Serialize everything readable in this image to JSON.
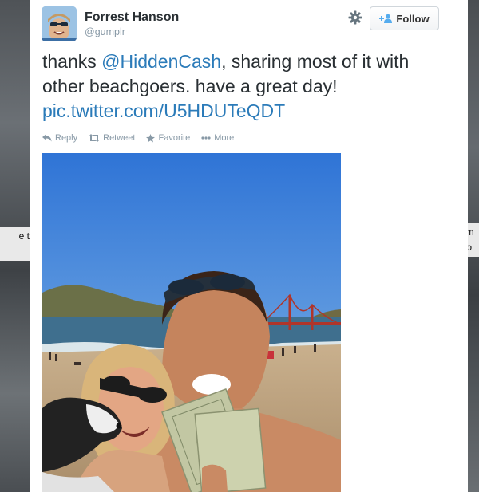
{
  "background": {
    "left_fragment": "e t",
    "right_fragment": "im fo"
  },
  "tweet": {
    "author": {
      "name": "Forrest Hanson",
      "handle": "@gumplr"
    },
    "follow_button": {
      "label": "Follow",
      "icon": "add-user-icon"
    },
    "settings_icon": "gear-icon",
    "text_before": "thanks ",
    "mention": "@HiddenCash",
    "text_after": ", sharing most of it with other beachgoers. have a great day! ",
    "link": "pic.twitter.com/U5HDUTeQDT",
    "actions": [
      {
        "label": "Reply",
        "icon": "reply-icon"
      },
      {
        "label": "Retweet",
        "icon": "retweet-icon"
      },
      {
        "label": "Favorite",
        "icon": "star-icon"
      },
      {
        "label": "More",
        "icon": "more-dots-icon"
      }
    ]
  },
  "colors": {
    "link": "#2b7bb9",
    "text": "#292f33",
    "muted": "#8899a6"
  }
}
